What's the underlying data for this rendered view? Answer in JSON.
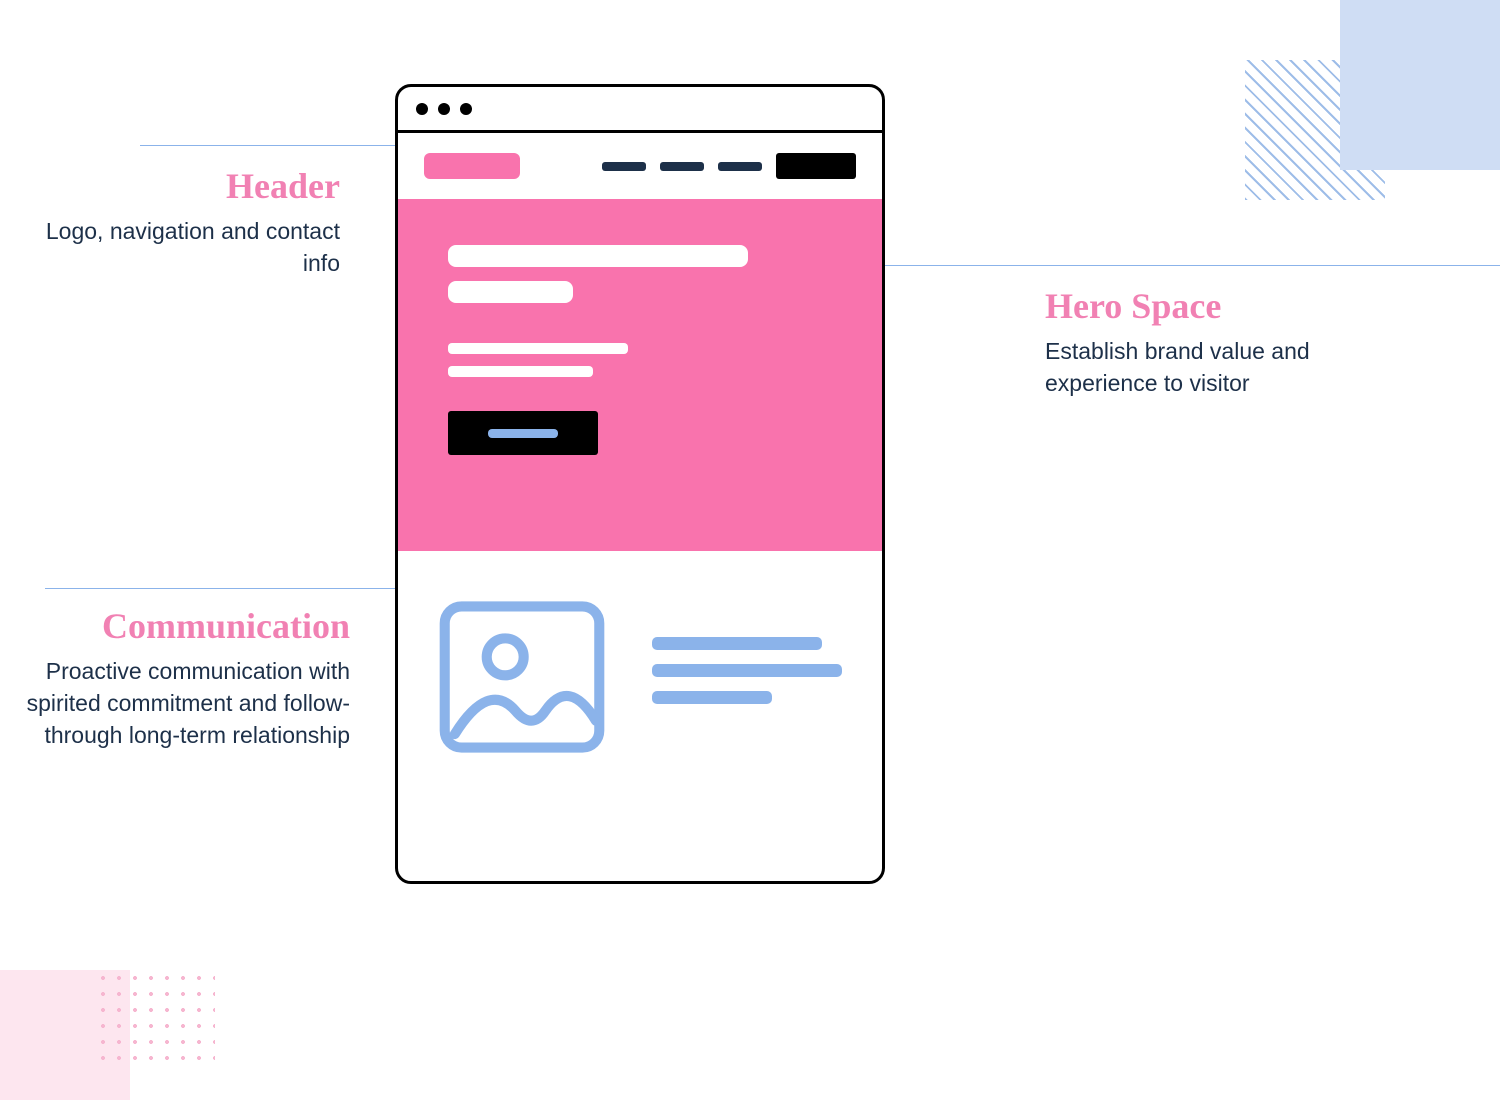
{
  "annotations": {
    "header": {
      "title": "Header",
      "desc": "Logo, navigation and contact info"
    },
    "hero": {
      "title": "Hero Space",
      "desc": "Establish brand value and experience to visitor"
    },
    "communication": {
      "title": "Communication",
      "desc": "Proactive communication with spirited commitment and follow-through long-term relationship"
    }
  },
  "colors": {
    "accent_pink": "#f973ad",
    "accent_blue": "#8bb3ea",
    "text_dark": "#1d3049"
  },
  "icons": {
    "image_placeholder": "image-placeholder-icon"
  }
}
